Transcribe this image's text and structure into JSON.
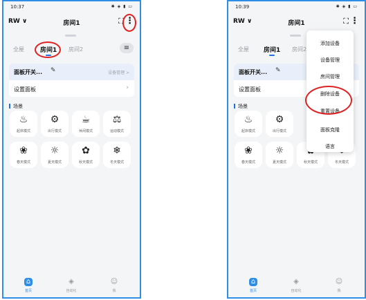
{
  "screens": [
    {
      "status": {
        "time": "10:37",
        "icons": "✱ ◈ ▮ ▭"
      },
      "topbar": {
        "home": "RW ∨",
        "title": "房间1"
      },
      "tabs": [
        "全屋",
        "房间1",
        "房间2"
      ],
      "panel": {
        "name": "面板开关...",
        "device_manage": "设备管理 >",
        "settings": "设置面板"
      },
      "scene_label": "场景",
      "scenes": [
        "起床模式",
        "出行模式",
        "休闲模式",
        "运动模式",
        "春天模式",
        "夏天模式",
        "秋天模式",
        "冬天模式"
      ],
      "nav": [
        "首页",
        "自动化",
        "我"
      ]
    },
    {
      "status": {
        "time": "10:39",
        "icons": "✱ ◈ ▮ ▭"
      },
      "topbar": {
        "home": "RW ∨",
        "title": "房间1"
      },
      "tabs": [
        "全屋",
        "房间1",
        "房间2"
      ],
      "panel": {
        "name": "面板开关...",
        "settings": "设置面板"
      },
      "scene_label": "场景",
      "scenes": [
        "起床模式",
        "出行模式",
        "春天模式",
        "夏天模式",
        "秋天模式",
        "冬天模式"
      ],
      "nav": [
        "首页",
        "自动化",
        "我"
      ],
      "dropdown": [
        "添加设备",
        "设备管理",
        "房间管理",
        "删除设备",
        "重置设备",
        "面板克隆",
        "语言"
      ]
    }
  ],
  "icons": {
    "scan": "⛶",
    "more": "⋮",
    "menu": "≡",
    "edit": "✎",
    "arrow": "›",
    "wake": "♨",
    "travel": "⚙",
    "leisure": "☕",
    "sport": "⚖",
    "spring": "❀",
    "summer": "☼",
    "autumn": "✿",
    "winter": "❄",
    "home": "⌂",
    "auto": "◈",
    "me": "☺"
  },
  "colors": {
    "accent": "#2e8ee6",
    "highlight": "#e02020"
  }
}
